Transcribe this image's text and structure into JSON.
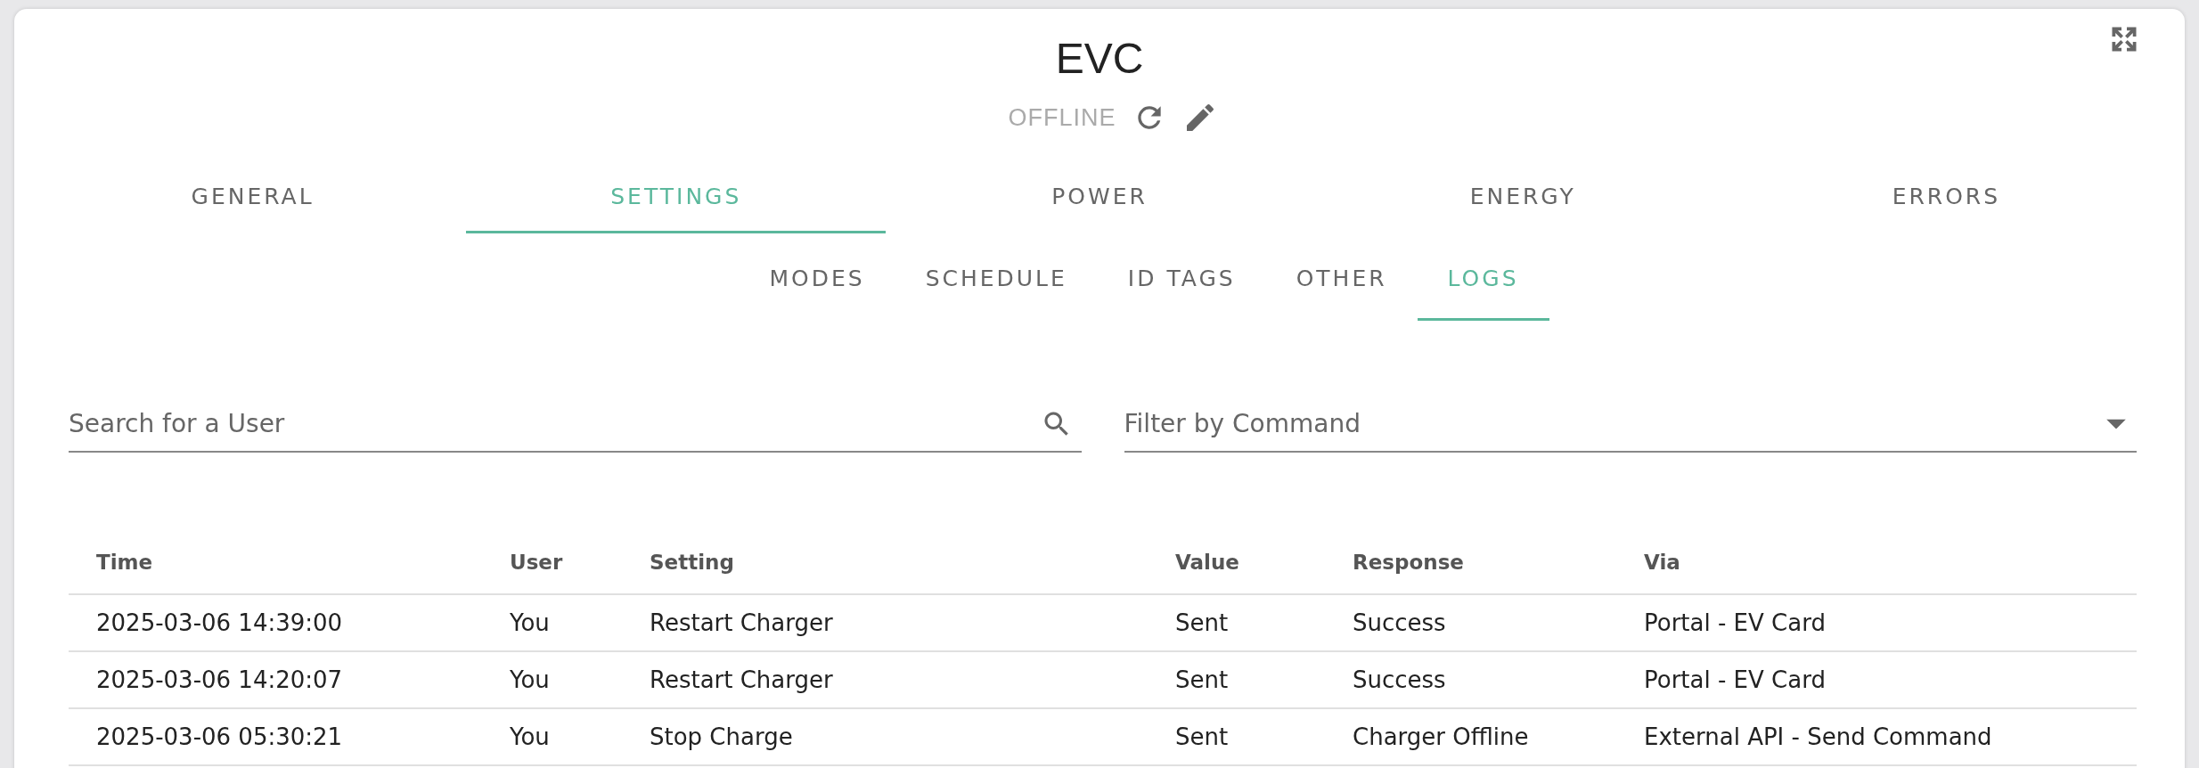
{
  "device": {
    "title": "EVC",
    "status": "OFFLINE"
  },
  "tabs": [
    {
      "label": "GENERAL",
      "selected": false
    },
    {
      "label": "SETTINGS",
      "selected": true
    },
    {
      "label": "POWER",
      "selected": false
    },
    {
      "label": "ENERGY",
      "selected": false
    },
    {
      "label": "ERRORS",
      "selected": false
    }
  ],
  "subtabs": [
    {
      "label": "MODES",
      "selected": false
    },
    {
      "label": "SCHEDULE",
      "selected": false
    },
    {
      "label": "ID TAGS",
      "selected": false
    },
    {
      "label": "OTHER",
      "selected": false
    },
    {
      "label": "LOGS",
      "selected": true
    }
  ],
  "search": {
    "placeholder": "Search for a User"
  },
  "filter": {
    "placeholder": "Filter by Command"
  },
  "table": {
    "columns": [
      "Time",
      "User",
      "Setting",
      "Value",
      "Response",
      "Via"
    ],
    "rows": [
      [
        "2025-03-06 14:39:00",
        "You",
        "Restart Charger",
        "Sent",
        "Success",
        "Portal - EV Card"
      ],
      [
        "2025-03-06 14:20:07",
        "You",
        "Restart Charger",
        "Sent",
        "Success",
        "Portal - EV Card"
      ],
      [
        "2025-03-06 05:30:21",
        "You",
        "Stop Charge",
        "Sent",
        "Charger Offline",
        "External API - Send Command"
      ]
    ]
  }
}
